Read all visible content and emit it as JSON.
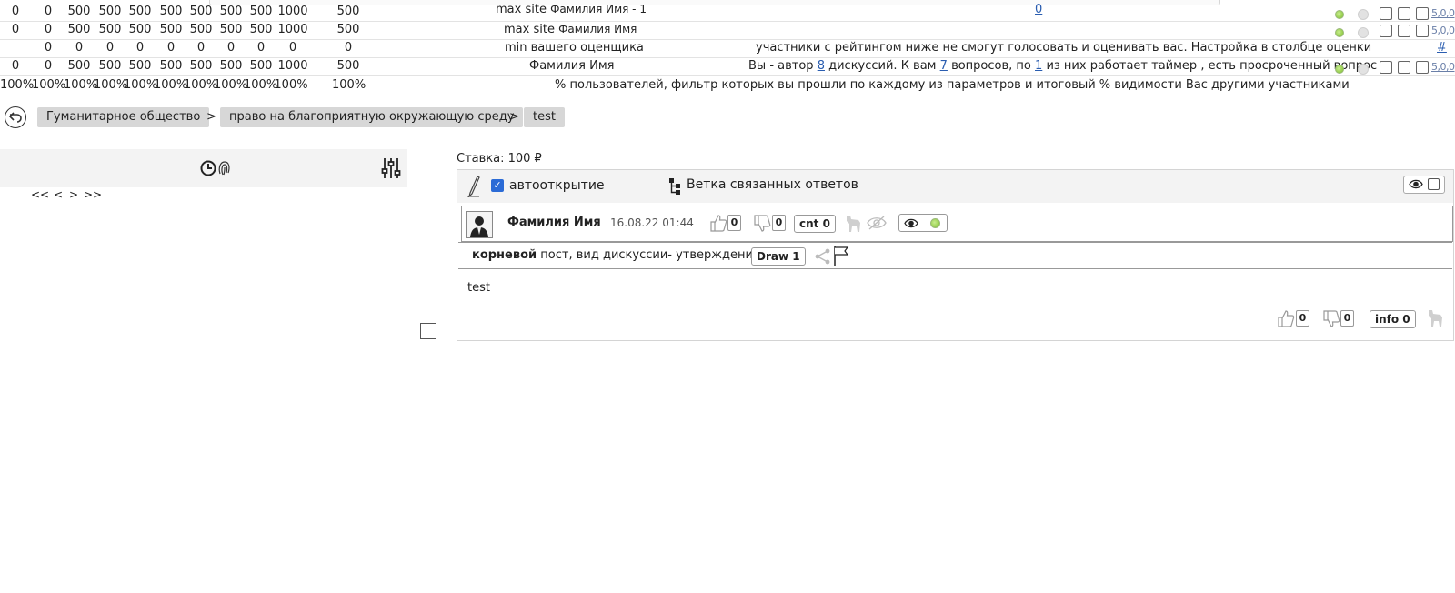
{
  "table": {
    "rows": [
      {
        "cells": [
          "0",
          "0",
          "500",
          "500",
          "500",
          "500",
          "500",
          "500",
          "500",
          "1000"
        ],
        "total": "500",
        "label_prefix": "max site",
        "label_name": "Фамилия Имя - 1",
        "right_link": "0"
      },
      {
        "cells": [
          "0",
          "0",
          "500",
          "500",
          "500",
          "500",
          "500",
          "500",
          "500",
          "1000"
        ],
        "total": "500",
        "label_prefix": "max site",
        "label_name": "Фамилия Имя"
      },
      {
        "cells": [
          "",
          "0",
          "0",
          "0",
          "0",
          "0",
          "0",
          "0",
          "0",
          "0"
        ],
        "total": "0",
        "label": "min вашего оценщика",
        "note": "участники с рейтингом ниже не смогут голосовать и оценивать вас. Настройка в столбце оценки",
        "hash": "#"
      },
      {
        "cells": [
          "0",
          "0",
          "500",
          "500",
          "500",
          "500",
          "500",
          "500",
          "500",
          "1000"
        ],
        "total": "500",
        "label": "Фамилия Имя",
        "author_pre": "Вы - автор",
        "author_n1": "8",
        "author_mid1": "дискуссий. К вам",
        "author_n2": "7",
        "author_mid2": "вопросов, по",
        "author_n3": "1",
        "author_post": "из них работает таймер , есть просроченный вопрос"
      },
      {
        "cells": [
          "100%",
          "100%",
          "100%",
          "100%",
          "100%",
          "100%",
          "100%",
          "100%",
          "100%",
          "100%"
        ],
        "total": "100%",
        "note": "% пользователей, фильтр которых вы прошли по каждому из параметров и итоговый % видимости Вас другими участниками"
      }
    ],
    "rating_link": "5,0,0"
  },
  "breadcrumb": {
    "items": [
      "Гуманитарное общество",
      "право на благоприятную окружающую среду",
      "test"
    ],
    "separator": ">"
  },
  "pager": {
    "first": "<<",
    "prev": "<",
    "next": ">",
    "last": ">>"
  },
  "stake": "Ставка: 100 ₽",
  "toolbar": {
    "autoopen_label": "автооткрытие",
    "autoopen_checked": true,
    "branch_label": "Ветка связанных ответов"
  },
  "post": {
    "author": "Фамилия Имя",
    "datetime": "16.08.22 01:44",
    "likes": "0",
    "dislikes": "0",
    "cnt_label": "cnt 0",
    "meta_bold": "корневой",
    "meta_text": "пост, вид дискуссии- утверждение",
    "draw_label": "Draw 1",
    "body": "test",
    "footer_likes": "0",
    "footer_dislikes": "0",
    "info_label": "info 0"
  },
  "colors": {
    "accent": "#2b6bd6",
    "link": "#2a5db0",
    "status_green": "#7cbf2b",
    "crumb_bg": "#d7d7d7"
  }
}
